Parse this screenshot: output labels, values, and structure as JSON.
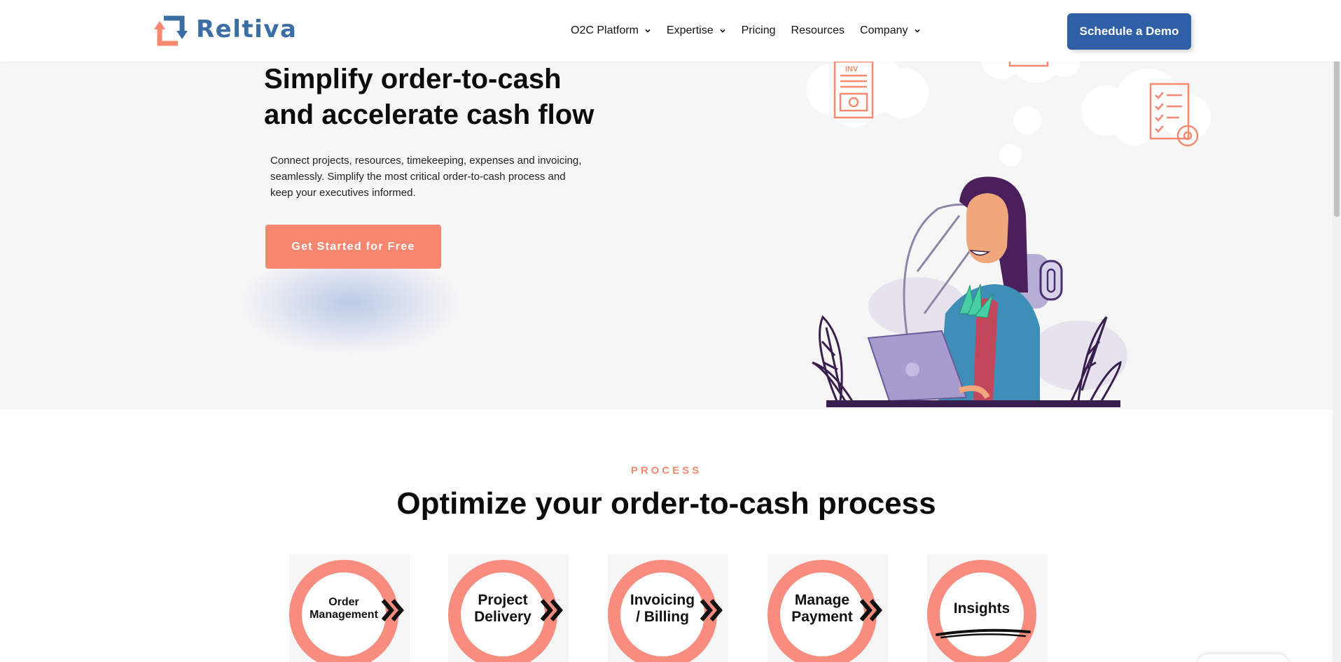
{
  "brand": {
    "name": "Reltiva",
    "color": "#3a6ea5",
    "accent": "#f98770"
  },
  "nav": {
    "items": [
      {
        "label": "O2C Platform",
        "has_dropdown": true
      },
      {
        "label": "Expertise",
        "has_dropdown": true
      },
      {
        "label": "Pricing",
        "has_dropdown": false
      },
      {
        "label": "Resources",
        "has_dropdown": false
      },
      {
        "label": "Company",
        "has_dropdown": true
      }
    ],
    "demo_button": "Schedule a Demo"
  },
  "hero": {
    "title_line1": "Simplify order-to-cash",
    "title_line2": "and accelerate cash flow",
    "description": "Connect projects, resources, timekeeping, expenses and invoicing, seamlessly. Simplify the most critical order-to-cash process and keep your executives informed.",
    "cta": "Get Started for Free",
    "illustration_labels": {
      "invoice_doc": "INV"
    }
  },
  "process": {
    "eyebrow": "PROCESS",
    "title": "Optimize your order-to-cash process",
    "steps": [
      {
        "line1": "Order",
        "line2": "Management",
        "icon": "double-chevron-right-icon"
      },
      {
        "line1": "Project",
        "line2": "Delivery",
        "icon": "double-chevron-right-icon"
      },
      {
        "line1": "Invoicing",
        "line2": "/ Billing",
        "icon": "double-chevron-right-icon"
      },
      {
        "line1": "Manage",
        "line2": "Payment",
        "icon": "double-chevron-right-icon"
      },
      {
        "line1": "Insights",
        "line2": "",
        "icon": "brush-underline"
      }
    ]
  }
}
